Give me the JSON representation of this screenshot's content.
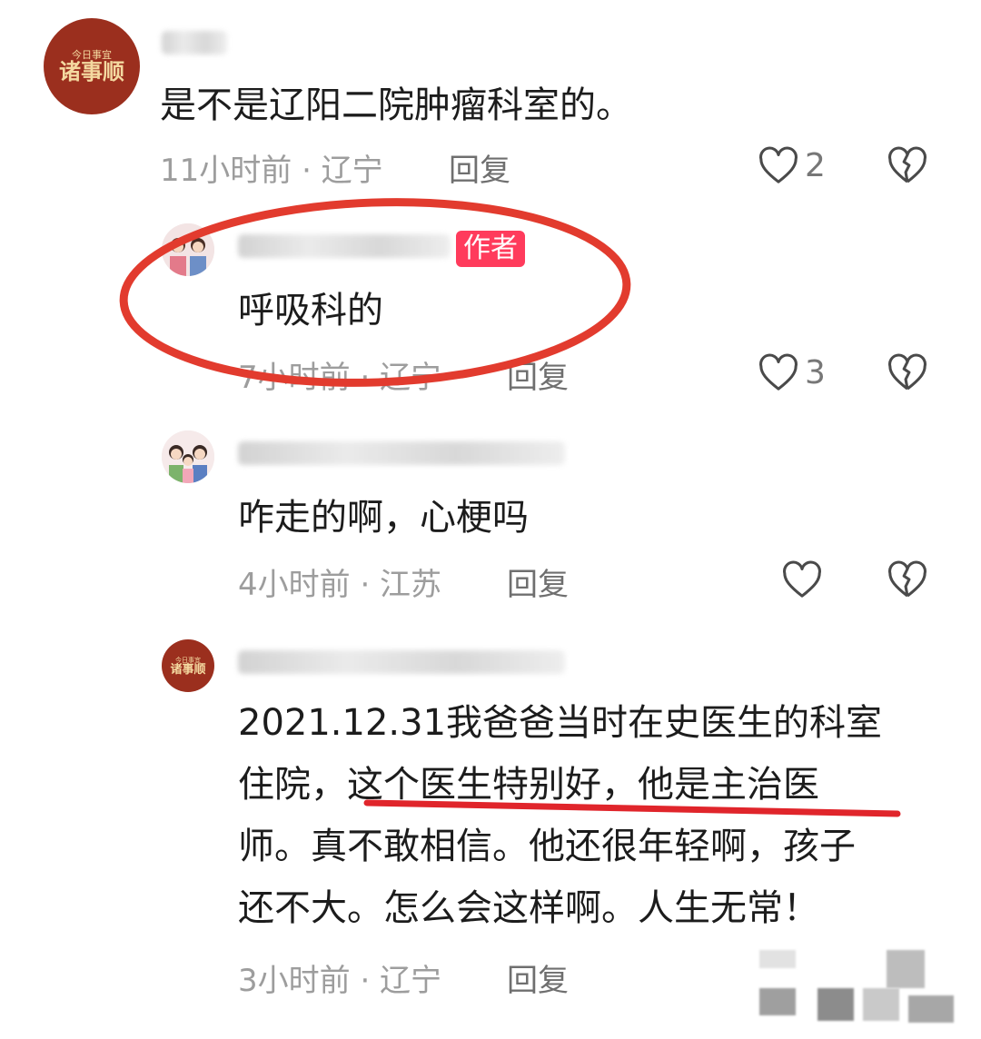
{
  "comments": [
    {
      "avatar": {
        "top": "今日事宜",
        "main": "诸事顺"
      },
      "text": "是不是辽阳二院肿瘤科室的。",
      "time": "11小时前 · 辽宁",
      "reply_label": "回复",
      "likes": "2"
    },
    {
      "badge": "作者",
      "text": "呼吸科的",
      "time": "7小时前 · 辽宁",
      "reply_label": "回复",
      "likes": "3"
    },
    {
      "text": "咋走的啊，心梗吗",
      "time": "4小时前 · 江苏",
      "reply_label": "回复",
      "likes": ""
    },
    {
      "avatar": {
        "top": "今日事宜",
        "main": "诸事顺"
      },
      "lines": [
        "2021.12.31我爸爸当时在史医生的科室",
        "住院，这个医生特别好，他是主治医",
        "师。真不敢相信。他还很年轻啊，孩子",
        "还不大。怎么会这样啊。人生无常！"
      ],
      "time": "3小时前 · 辽宁",
      "reply_label": "回复"
    }
  ],
  "colors": {
    "circle_annotation": "#e23b2e",
    "underline_annotation": "#e0252b",
    "badge": "#ff3b5c",
    "meta_text": "#9d9d9d"
  }
}
